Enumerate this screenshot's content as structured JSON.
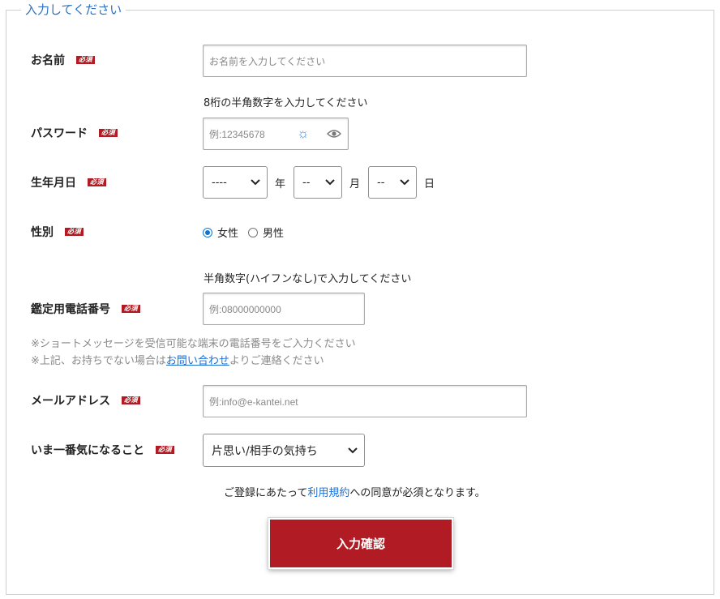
{
  "legend": "入力してください",
  "required_badge": "必須",
  "name": {
    "label": "お名前",
    "placeholder": "お名前を入力してください"
  },
  "password": {
    "label": "パスワード",
    "hint": "8桁の半角数字を入力してください",
    "placeholder": "例:12345678"
  },
  "birthday": {
    "label": "生年月日",
    "year_value": "----",
    "year_unit": "年",
    "month_value": "--",
    "month_unit": "月",
    "day_value": "--",
    "day_unit": "日"
  },
  "gender": {
    "label": "性別",
    "options": [
      "女性",
      "男性"
    ],
    "selected": "女性"
  },
  "phone": {
    "label": "鑑定用電話番号",
    "hint": "半角数字(ハイフンなし)で入力してください",
    "placeholder": "例:08000000000",
    "note1": "※ショートメッセージを受信可能な端末の電話番号をご入力ください",
    "note2_prefix": "※上記、お持ちでない場合は",
    "note2_link": "お問い合わせ",
    "note2_suffix": "よりご連絡ください"
  },
  "email": {
    "label": "メールアドレス",
    "placeholder": "例:info@e-kantei.net"
  },
  "concern": {
    "label": "いま一番気になること",
    "value": "片思い/相手の気持ち"
  },
  "terms": {
    "prefix": "ご登録にあたって",
    "link": "利用規約",
    "suffix": "への同意が必須となります。"
  },
  "submit_label": "入力確認",
  "colors": {
    "accent": "#b11c24",
    "link": "#1a6fd6",
    "legend": "#2f6fbf"
  }
}
